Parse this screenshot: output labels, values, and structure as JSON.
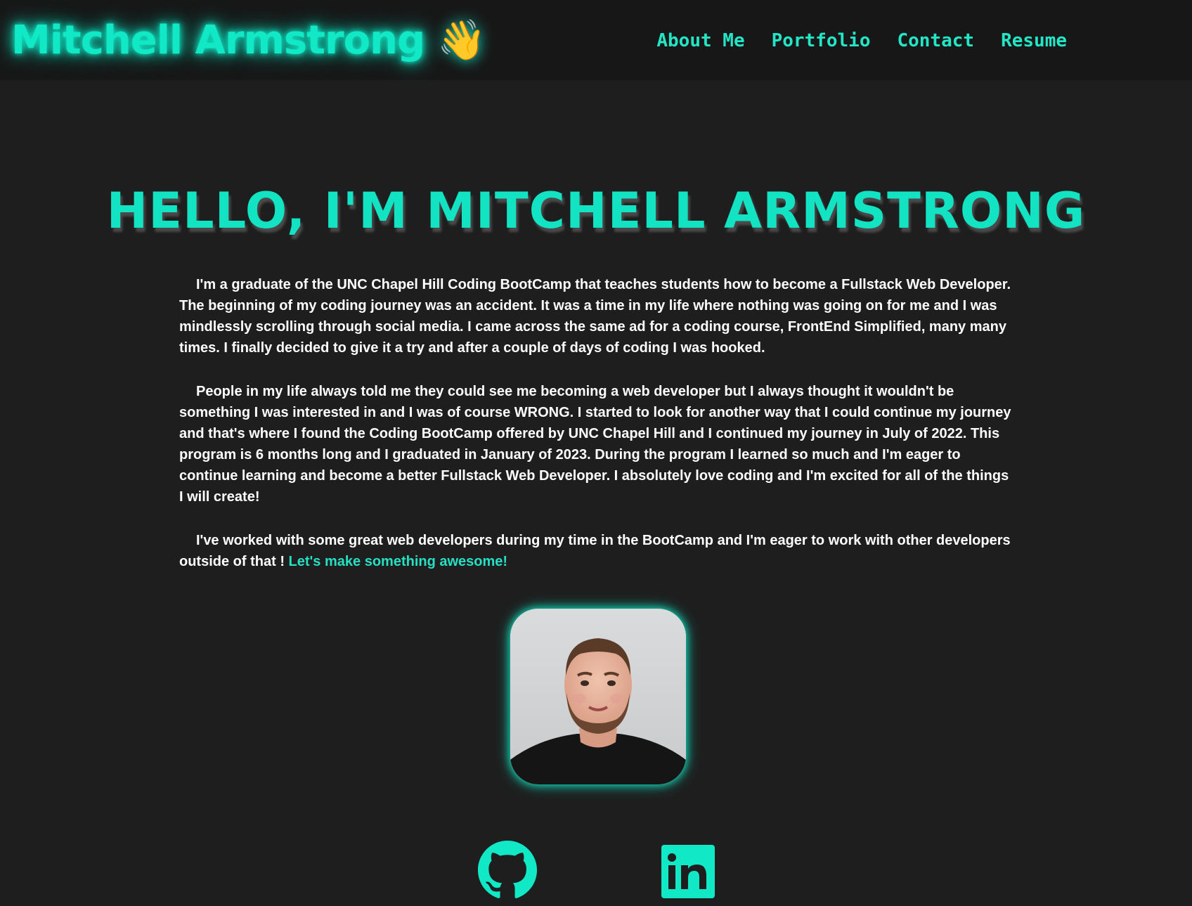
{
  "header": {
    "brand_name": "Mitchell Armstrong",
    "brand_emoji": "👋",
    "nav": [
      {
        "label": "About Me"
      },
      {
        "label": "Portfolio"
      },
      {
        "label": "Contact"
      },
      {
        "label": "Resume"
      }
    ]
  },
  "main": {
    "title": "HELLO, I'M MITCHELL ARMSTRONG",
    "paragraphs": [
      "I'm a graduate of the UNC Chapel Hill Coding BootCamp that teaches students how to become a Fullstack Web Developer. The beginning of my coding journey was an accident. It was a time in my life where nothing was going on for me and I was mindlessly scrolling through social media. I came across the same ad for a coding course, FrontEnd Simplified, many many times. I finally decided to give it a try and after a couple of days of coding I was hooked.",
      "People in my life always told me they could see me becoming a web developer but I always thought it wouldn't be something I was interested in and I was of course WRONG. I started to look for another way that I could continue my journey and that's where I found the Coding BootCamp offered by UNC Chapel Hill and I continued my journey in July of 2022. This program is 6 months long and I graduated in January of 2023. During the program I learned so much and I'm eager to continue learning and become a better Fullstack Web Developer. I absolutely love coding and I'm excited for all of the things I will create!"
    ],
    "last_paragraph": "I've worked with some great web developers during my time in the BootCamp and I'm eager to work with other developers outside of that ! ",
    "cta": "Let's make something awesome!"
  },
  "socials": [
    {
      "icon": "github-icon"
    },
    {
      "icon": "linkedin-icon"
    }
  ],
  "colors": {
    "accent": "#10e8c6",
    "background": "#1e1e1e",
    "header_background": "#171717",
    "text": "#ffffff"
  }
}
